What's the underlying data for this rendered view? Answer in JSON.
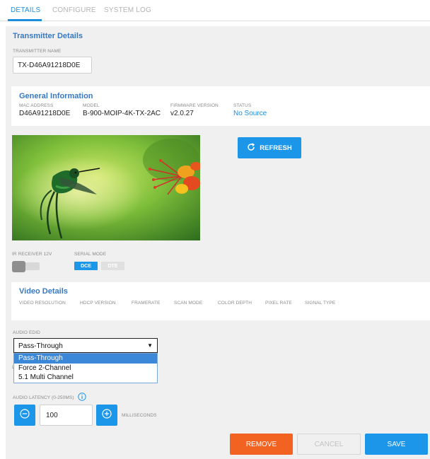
{
  "tabs": [
    {
      "label": "DETAILS",
      "active": true
    },
    {
      "label": "CONFIGURE",
      "active": false
    },
    {
      "label": "SYSTEM LOG",
      "active": false
    }
  ],
  "transmitter": {
    "section_title": "Transmitter Details",
    "name_label": "TRANSMITTER NAME",
    "name_value": "TX-D46A91218D0E"
  },
  "general": {
    "section_title": "General Information",
    "mac_label": "MAC ADDRESS",
    "mac_value": "D46A91218D0E",
    "model_label": "MODEL",
    "model_value": "B-900-MOIP-4K-TX-2AC",
    "firmware_label": "FIRMWARE VERSION",
    "firmware_value": "v2.0.27",
    "status_label": "STATUS",
    "status_value": "No Source",
    "status_color": "#1c8fe0"
  },
  "preview": {
    "refresh_label": "REFRESH",
    "refresh_icon": "refresh-icon"
  },
  "ir": {
    "label": "IR RECEIVER 12V",
    "enabled": false
  },
  "serial": {
    "label": "SERIAL MODE",
    "options": [
      "DCE",
      "DTE"
    ],
    "selected": "DCE"
  },
  "video": {
    "section_title": "Video Details",
    "columns": [
      "VIDEO RESOLUTION",
      "HDCP VERSION",
      "FRAMERATE",
      "SCAN MODE",
      "COLOR DEPTH",
      "PIXEL RATE",
      "SIGNAL TYPE"
    ]
  },
  "audio_edid": {
    "label": "AUDIO EDID",
    "selected": "Pass-Through",
    "options": [
      "Pass-Through",
      "Force 2-Channel",
      "5.1 Multi Channel"
    ],
    "hidden_label_fragment": "L"
  },
  "latency": {
    "label": "AUDIO LATENCY (0-250MS)",
    "info_icon": "info-icon",
    "value": "100",
    "unit": "MILLISECONDS",
    "decrement_icon": "minus-circle-icon",
    "increment_icon": "plus-circle-icon"
  },
  "actions": {
    "remove": "REMOVE",
    "cancel": "CANCEL",
    "save": "SAVE"
  },
  "colors": {
    "accent": "#1c96e8",
    "danger": "#f26322",
    "title": "#3778c4"
  }
}
